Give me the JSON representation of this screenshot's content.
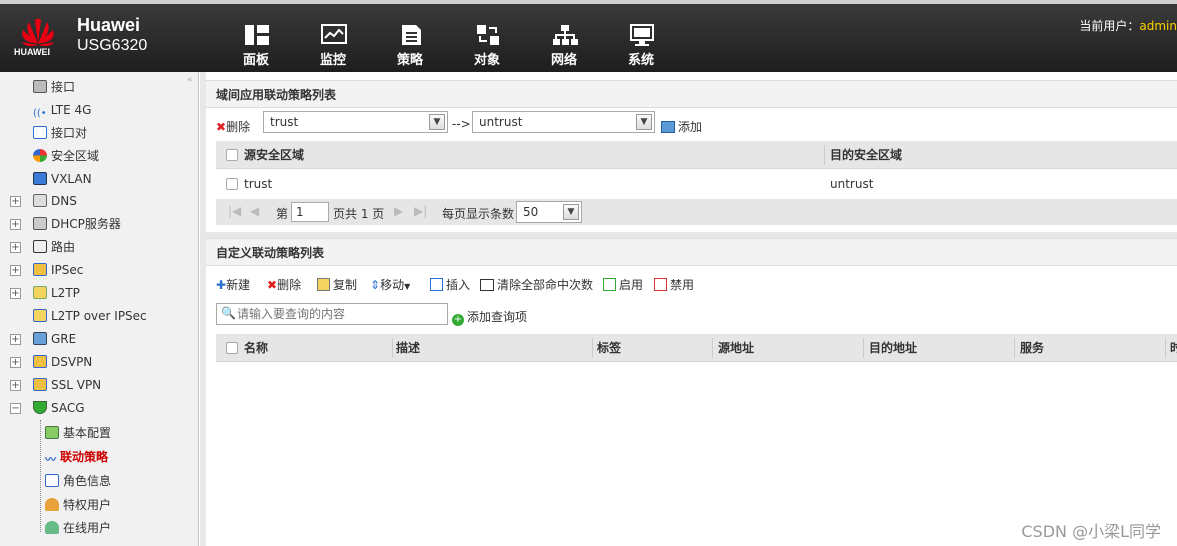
{
  "brand": {
    "logo_text": "HUAWEI",
    "name": "Huawei",
    "model": "USG6320"
  },
  "nav": [
    {
      "label": "面板",
      "icon": "dashboard-icon"
    },
    {
      "label": "监控",
      "icon": "monitor-icon"
    },
    {
      "label": "策略",
      "icon": "policy-icon"
    },
    {
      "label": "对象",
      "icon": "object-icon"
    },
    {
      "label": "网络",
      "icon": "network-icon"
    },
    {
      "label": "系统",
      "icon": "system-icon"
    }
  ],
  "user": {
    "label": "当前用户：",
    "name": "admin"
  },
  "sidebar": {
    "items": [
      {
        "label": "接口",
        "icon": "interface-icon"
      },
      {
        "label": "LTE 4G",
        "icon": "lte-icon"
      },
      {
        "label": "接口对",
        "icon": "interface-pair-icon"
      },
      {
        "label": "安全区域",
        "icon": "security-zone-icon"
      },
      {
        "label": "VXLAN",
        "icon": "vxlan-icon"
      },
      {
        "label": "DNS",
        "icon": "dns-icon"
      },
      {
        "label": "DHCP服务器",
        "icon": "dhcp-icon"
      },
      {
        "label": "路由",
        "icon": "route-icon"
      },
      {
        "label": "IPSec",
        "icon": "ipsec-icon"
      },
      {
        "label": "L2TP",
        "icon": "l2tp-icon"
      },
      {
        "label": "L2TP over IPSec",
        "icon": "l2tp-ipsec-icon"
      },
      {
        "label": "GRE",
        "icon": "gre-icon"
      },
      {
        "label": "DSVPN",
        "icon": "dsvpn-icon"
      },
      {
        "label": "SSL VPN",
        "icon": "sslvpn-icon"
      },
      {
        "label": "SACG",
        "icon": "sacg-icon"
      }
    ],
    "sacg_children": [
      {
        "label": "基本配置"
      },
      {
        "label": "联动策略"
      },
      {
        "label": "角色信息"
      },
      {
        "label": "特权用户"
      },
      {
        "label": "在线用户"
      }
    ]
  },
  "zone_panel": {
    "title": "域间应用联动策略列表",
    "delete_label": "删除",
    "src_select": "trust",
    "arrow": "-->",
    "dst_select": "untrust",
    "add_label": "添加",
    "col_src": "源安全区域",
    "col_dst": "目的安全区域",
    "rows": [
      {
        "src": "trust",
        "dst": "untrust"
      }
    ],
    "pager": {
      "page_prefix": "第",
      "page": "1",
      "page_suffix": "页共 1 页",
      "per_page_label": "每页显示条数",
      "per_page": "50"
    }
  },
  "custom_panel": {
    "title": "自定义联动策略列表",
    "toolbar": {
      "new": "新建",
      "delete": "删除",
      "copy": "复制",
      "move": "移动",
      "insert": "插入",
      "clear": "清除全部命中次数",
      "enable": "启用",
      "disable": "禁用"
    },
    "search_placeholder": "请输入要查询的内容",
    "add_query": "添加查询项",
    "columns": [
      "名称",
      "描述",
      "标签",
      "源地址",
      "目的地址",
      "服务",
      "时"
    ]
  },
  "watermark": "CSDN @小梁L同学"
}
